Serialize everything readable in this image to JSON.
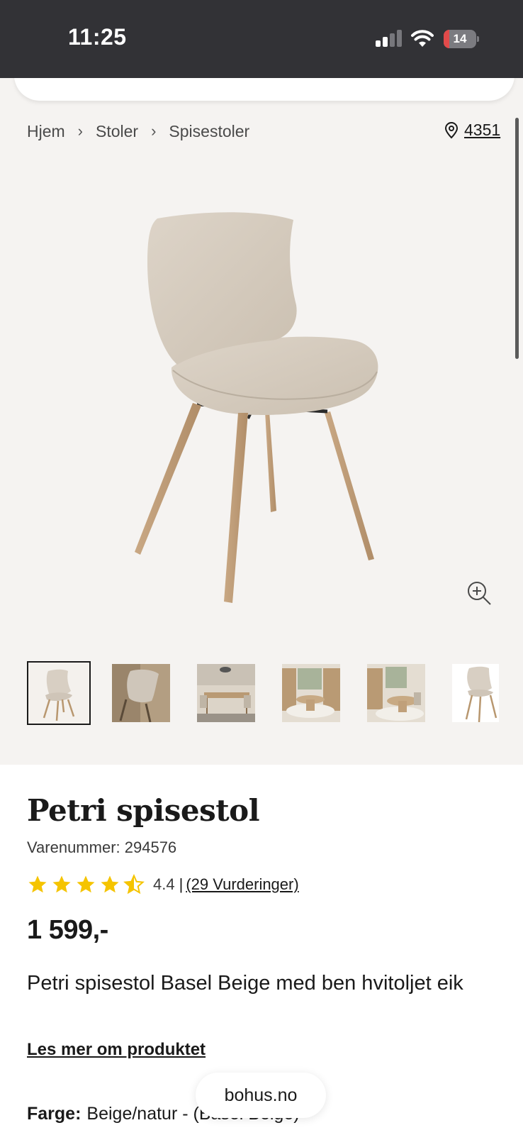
{
  "status_bar": {
    "time": "11:25",
    "battery_level": "14"
  },
  "breadcrumb": {
    "items": [
      "Hjem",
      "Stoler",
      "Spisestoler"
    ]
  },
  "store": {
    "code": "4351",
    "icon": "location-pin-icon"
  },
  "gallery": {
    "zoom_icon": "zoom-in-icon",
    "thumbnail_count": 6,
    "selected_index": 0
  },
  "product": {
    "title": "Petri spisestol",
    "sku": "Varenummer: 294576",
    "rating": 4.4,
    "rating_text": "4.4",
    "separator": "|",
    "reviews_link": "(29 Vurderinger)",
    "price": "1 599,-",
    "description": "Petri spisestol Basel Beige med ben hvitoljet eik",
    "read_more": "Les mer om produktet",
    "color_label": "Farge:",
    "color_value": "Beige/natur - (Basel Beige)"
  },
  "browser": {
    "domain": "bohus.no"
  },
  "colors": {
    "status_bar_bg": "#323236",
    "gallery_bg": "#f5f3f1",
    "star": "#f5c400",
    "text": "#1a1a1a"
  }
}
